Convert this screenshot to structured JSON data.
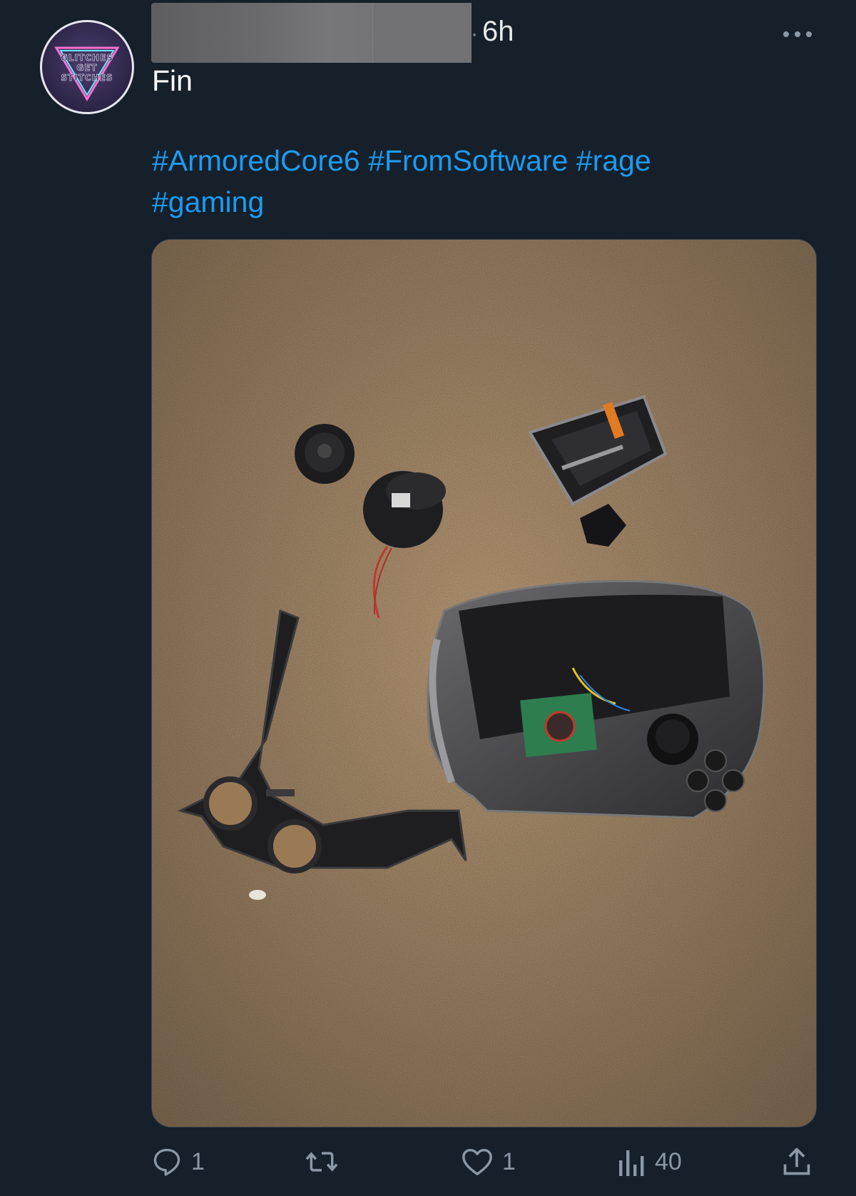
{
  "tweet": {
    "author_avatar": {
      "logo_text_lines": [
        "GLITCHES",
        "GET",
        "STITCHES"
      ]
    },
    "timestamp": "6h",
    "timestamp_separator": "·",
    "text": "Fin",
    "hashtags": [
      "#ArmoredCore6",
      "#FromSoftware",
      "#rage",
      "#gaming"
    ],
    "actions": {
      "reply_count": "1",
      "retweet_count": "",
      "like_count": "1",
      "views_count": "40"
    },
    "icons": {
      "more": "more-horizontal-icon",
      "reply": "reply-icon",
      "retweet": "retweet-icon",
      "like": "heart-icon",
      "views": "views-chart-icon",
      "share": "share-icon"
    },
    "colors": {
      "background": "#15202b",
      "link": "#1d9bf0",
      "secondary_text": "#8b98a5",
      "primary_text": "#e7e9ea"
    }
  }
}
